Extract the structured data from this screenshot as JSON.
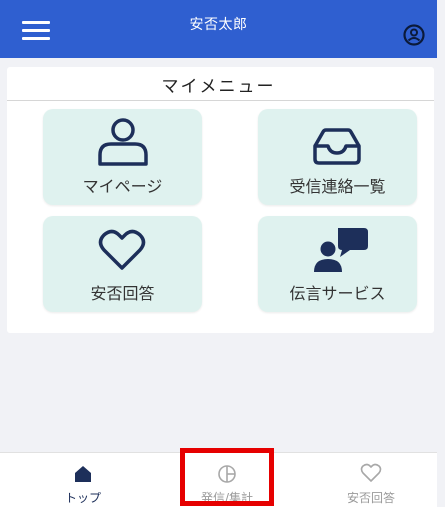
{
  "header": {
    "title": "安否太郎",
    "menu_icon": "hamburger-icon",
    "account_icon": "account-icon"
  },
  "menu": {
    "title": "マイメニュー",
    "items": [
      {
        "label": "マイページ",
        "icon": "person-icon"
      },
      {
        "label": "受信連絡一覧",
        "icon": "inbox-icon"
      },
      {
        "label": "安否回答",
        "icon": "heart-icon"
      },
      {
        "label": "伝言サービス",
        "icon": "message-icon"
      }
    ]
  },
  "bottom_nav": {
    "items": [
      {
        "label": "トップ",
        "icon": "home-icon",
        "active": true
      },
      {
        "label": "発信/集計",
        "icon": "chart-icon",
        "active": false
      },
      {
        "label": "安否回答",
        "icon": "heart-icon",
        "active": false
      }
    ]
  },
  "colors": {
    "header": "#2f5fd0",
    "tile": "#dff2ef",
    "icon_dark": "#1d2f5a",
    "highlight": "#e60000"
  }
}
